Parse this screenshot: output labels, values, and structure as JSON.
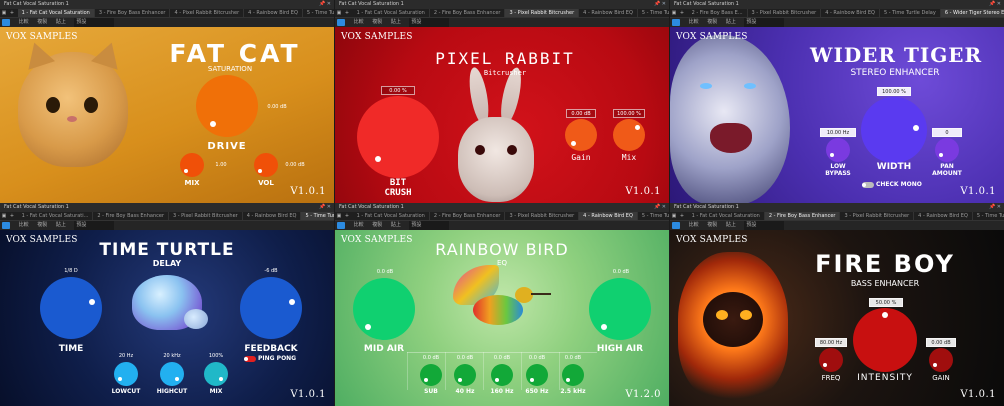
{
  "panels": [
    {
      "window_title": "Fat Cat Vocal Saturation 1",
      "tabs": [
        "1 - Fat Cat Vocal Saturation",
        "3 - Fire Boy Bass Enhancer",
        "4 - Pixel Rabbit Bitcrusher",
        "4 - Rainbow Bird EQ",
        "5 - Time Turtle D..."
      ],
      "active_tab": 0,
      "toolbar": [
        "比較",
        "複製",
        "貼上",
        "預設"
      ],
      "brand": "VOX SAMPLES",
      "title": "FAT CAT",
      "subtitle": "SATURATION",
      "controls": {
        "drive": {
          "label": "DRIVE",
          "value": "0.00 dB"
        },
        "mix": {
          "label": "MIX",
          "value": "1.00"
        },
        "vol": {
          "label": "VOL",
          "value": "0.00 dB"
        }
      },
      "version": "V1.0.1",
      "colors": {
        "knob": "#f07008"
      }
    },
    {
      "window_title": "Fat Cat Vocal Saturation 1",
      "tabs": [
        "1 - Fat Cat Vocal Saturation",
        "2 - Fire Boy Bass Enhancer",
        "3 - Pixel Rabbit Bitcrusher",
        "4 - Rainbow Bird EQ",
        "5 - Time Turtle D..."
      ],
      "active_tab": 2,
      "toolbar": [
        "比較",
        "複製",
        "貼上",
        "預設"
      ],
      "brand": "VOX SAMPLES",
      "title": "PIXEL RABBIT",
      "subtitle": "Bitcrusher",
      "controls": {
        "bitcrush": {
          "label_line1": "BIT",
          "label_line2": "CRUSH",
          "value": "0.00 %"
        },
        "gain": {
          "label": "Gain",
          "value": "0.00 dB"
        },
        "mix": {
          "label": "Mix",
          "value": "100.00 %"
        }
      },
      "version": "V1.0.1",
      "colors": {
        "big_knob": "#f02a28",
        "small_knob": "#f05a18"
      }
    },
    {
      "window_title": "Fat Cat Vocal Saturation 1",
      "tabs": [
        "2 - Fire Boy Bass E...",
        "3 - Pixel Rabbit Bitcrusher",
        "4 - Rainbow Bird EQ",
        "5 - Time Turtle Delay",
        "6 - Wider Tiger Stereo Enhancer"
      ],
      "active_tab": 4,
      "toolbar": [
        "比較",
        "複製",
        "貼上",
        "預設"
      ],
      "brand": "VOX SAMPLES",
      "title": "WIDER TIGER",
      "subtitle": "STEREO ENHANCER",
      "controls": {
        "width": {
          "label": "WIDTH",
          "value": "100.00 %"
        },
        "low_bypass": {
          "label_line1": "LOW",
          "label_line2": "BYPASS",
          "value": "10.00 Hz"
        },
        "pan_amount": {
          "label_line1": "PAN",
          "label_line2": "AMOUNT",
          "value": "0"
        },
        "check_mono": {
          "label": "CHECK MONO"
        }
      },
      "version": "V1.0.1",
      "colors": {
        "knob": "#5a3af0",
        "small_knob": "#7a3ae0"
      }
    },
    {
      "window_title": "Fat Cat Vocal Saturation 1",
      "tabs": [
        "1 - Fat Cat Vocal Saturati...",
        "2 - Fire Boy Bass Enhancer",
        "3 - Pixel Rabbit Bitcrusher",
        "4 - Rainbow Bird EQ",
        "5 - Time Turtle Delay"
      ],
      "active_tab": 4,
      "toolbar": [
        "比較",
        "複製",
        "貼上",
        "預設"
      ],
      "brand": "VOX SAMPLES",
      "title": "TIME TURTLE",
      "subtitle": "DELAY",
      "controls": {
        "time": {
          "label": "TIME",
          "value": "1/8 D"
        },
        "feedback": {
          "label": "FEEDBACK",
          "value": "-6 dB"
        },
        "lowcut": {
          "label": "LOWCUT",
          "value": "20 Hz"
        },
        "highcut": {
          "label": "HIGHCUT",
          "value": "20 kHz"
        },
        "mix": {
          "label": "MIX",
          "value": "100%"
        },
        "ping_pong": {
          "label": "PING PONG"
        }
      },
      "version": "V1.0.1",
      "colors": {
        "knob": "#1a5ad0",
        "small_knob": "#22b0f0",
        "mix_knob": "#20b8c8"
      }
    },
    {
      "window_title": "Fat Cat Vocal Saturation 1",
      "tabs": [
        "1 - Fat Cat Vocal Saturation",
        "2 - Fire Boy Bass Enhancer",
        "3 - Pixel Rabbit Bitcrusher",
        "4 - Rainbow Bird EQ",
        "5 - Time Turtle D..."
      ],
      "active_tab": 3,
      "toolbar": [
        "比較",
        "複製",
        "貼上",
        "預設"
      ],
      "brand": "VOX SAMPLES",
      "title": "RAINBOW BIRD",
      "subtitle": "EQ",
      "controls": {
        "mid_air": {
          "label": "MID AIR",
          "value": "0.0 dB"
        },
        "high_air": {
          "label": "HIGH AIR",
          "value": "0.0 dB"
        },
        "bands": [
          {
            "label": "SUB",
            "value": "0.0 dB"
          },
          {
            "label": "40 Hz",
            "value": "0.0 dB"
          },
          {
            "label": "160 Hz",
            "value": "0.0 dB"
          },
          {
            "label": "650 Hz",
            "value": "0.0 dB"
          },
          {
            "label": "2.5 kHz",
            "value": "0.0 dB"
          }
        ]
      },
      "version": "V1.2.0",
      "colors": {
        "knob": "#10d070",
        "small_knob": "#12a838"
      }
    },
    {
      "window_title": "Fat Cat Vocal Saturation 1",
      "tabs": [
        "1 - Fat Cat Vocal Saturation",
        "2 - Fire Boy Bass Enhancer",
        "3 - Pixel Rabbit Bitcrusher",
        "4 - Rainbow Bird EQ",
        "5 - Time Turtle Delay"
      ],
      "active_tab": 1,
      "toolbar": [
        "比較",
        "複製",
        "貼上",
        "預設"
      ],
      "brand": "VOX SAMPLES",
      "title": "FIRE BOY",
      "subtitle": "BASS ENHANCER",
      "controls": {
        "intensity": {
          "label": "INTENSITY",
          "value": "50.00 %"
        },
        "freq": {
          "label": "FREQ",
          "value": "80.00 Hz"
        },
        "gain": {
          "label": "GAIN",
          "value": "0.00 dB"
        }
      },
      "version": "V1.0.1",
      "colors": {
        "knob": "#c81010",
        "small_knob": "#a00e0e"
      }
    }
  ]
}
